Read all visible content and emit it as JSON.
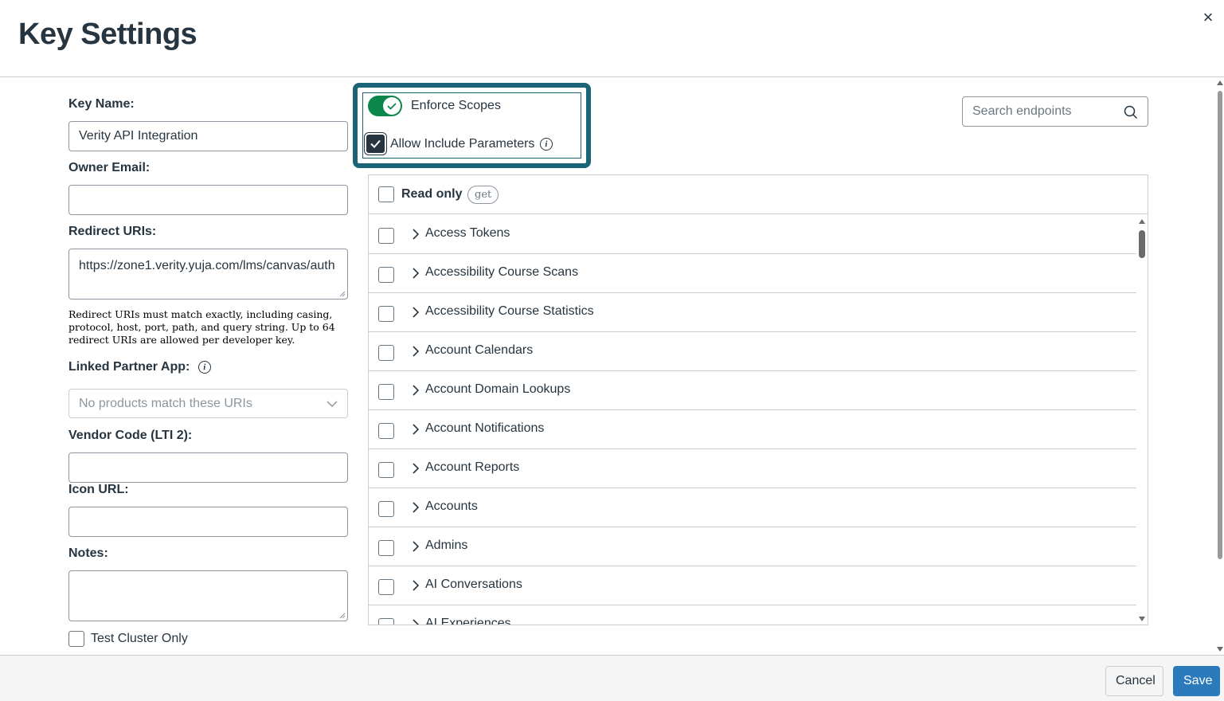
{
  "modal": {
    "title": "Key Settings",
    "close_label": "×"
  },
  "form": {
    "key_name_label": "Key Name:",
    "key_name_value": "Verity API Integration",
    "owner_email_label": "Owner Email:",
    "owner_email_value": "",
    "redirect_uris_label": "Redirect URIs:",
    "redirect_uris_value": "https://zone1.verity.yuja.com/lms/canvas/auth",
    "redirect_help": "Redirect URIs must match exactly, including casing, protocol, host, port, path, and query string. Up to 64 redirect URIs are allowed per developer key.",
    "linked_partner_label": "Linked Partner App:",
    "linked_partner_placeholder": "No products match these URIs",
    "vendor_code_label": "Vendor Code (LTI 2):",
    "vendor_code_value": "",
    "icon_url_label": "Icon URL:",
    "icon_url_value": "",
    "notes_label": "Notes:",
    "notes_value": "",
    "test_cluster_label": "Test Cluster Only",
    "test_cluster_checked": false
  },
  "scopes": {
    "enforce_label": "Enforce Scopes",
    "enforce_on": true,
    "allow_include_label": "Allow Include Parameters",
    "allow_include_checked": true,
    "search_placeholder": "Search endpoints",
    "read_only_label": "Read only",
    "read_only_badge": "get",
    "items": [
      {
        "label": "Access Tokens"
      },
      {
        "label": "Accessibility Course Scans"
      },
      {
        "label": "Accessibility Course Statistics"
      },
      {
        "label": "Account Calendars"
      },
      {
        "label": "Account Domain Lookups"
      },
      {
        "label": "Account Notifications"
      },
      {
        "label": "Account Reports"
      },
      {
        "label": "Accounts"
      },
      {
        "label": "Admins"
      },
      {
        "label": "AI Conversations"
      },
      {
        "label": "AI Experiences"
      }
    ]
  },
  "footer": {
    "cancel_label": "Cancel",
    "save_label": "Save"
  },
  "colors": {
    "accent": "#1b6377",
    "toggle_on": "#0b874b",
    "primary_button": "#2b7abc",
    "text": "#273540"
  },
  "icons": {
    "close": "close-icon",
    "info": "info-icon",
    "chevron_down": "chevron-down-icon",
    "chevron_right": "chevron-right-icon",
    "search": "search-icon",
    "check": "check-icon"
  }
}
